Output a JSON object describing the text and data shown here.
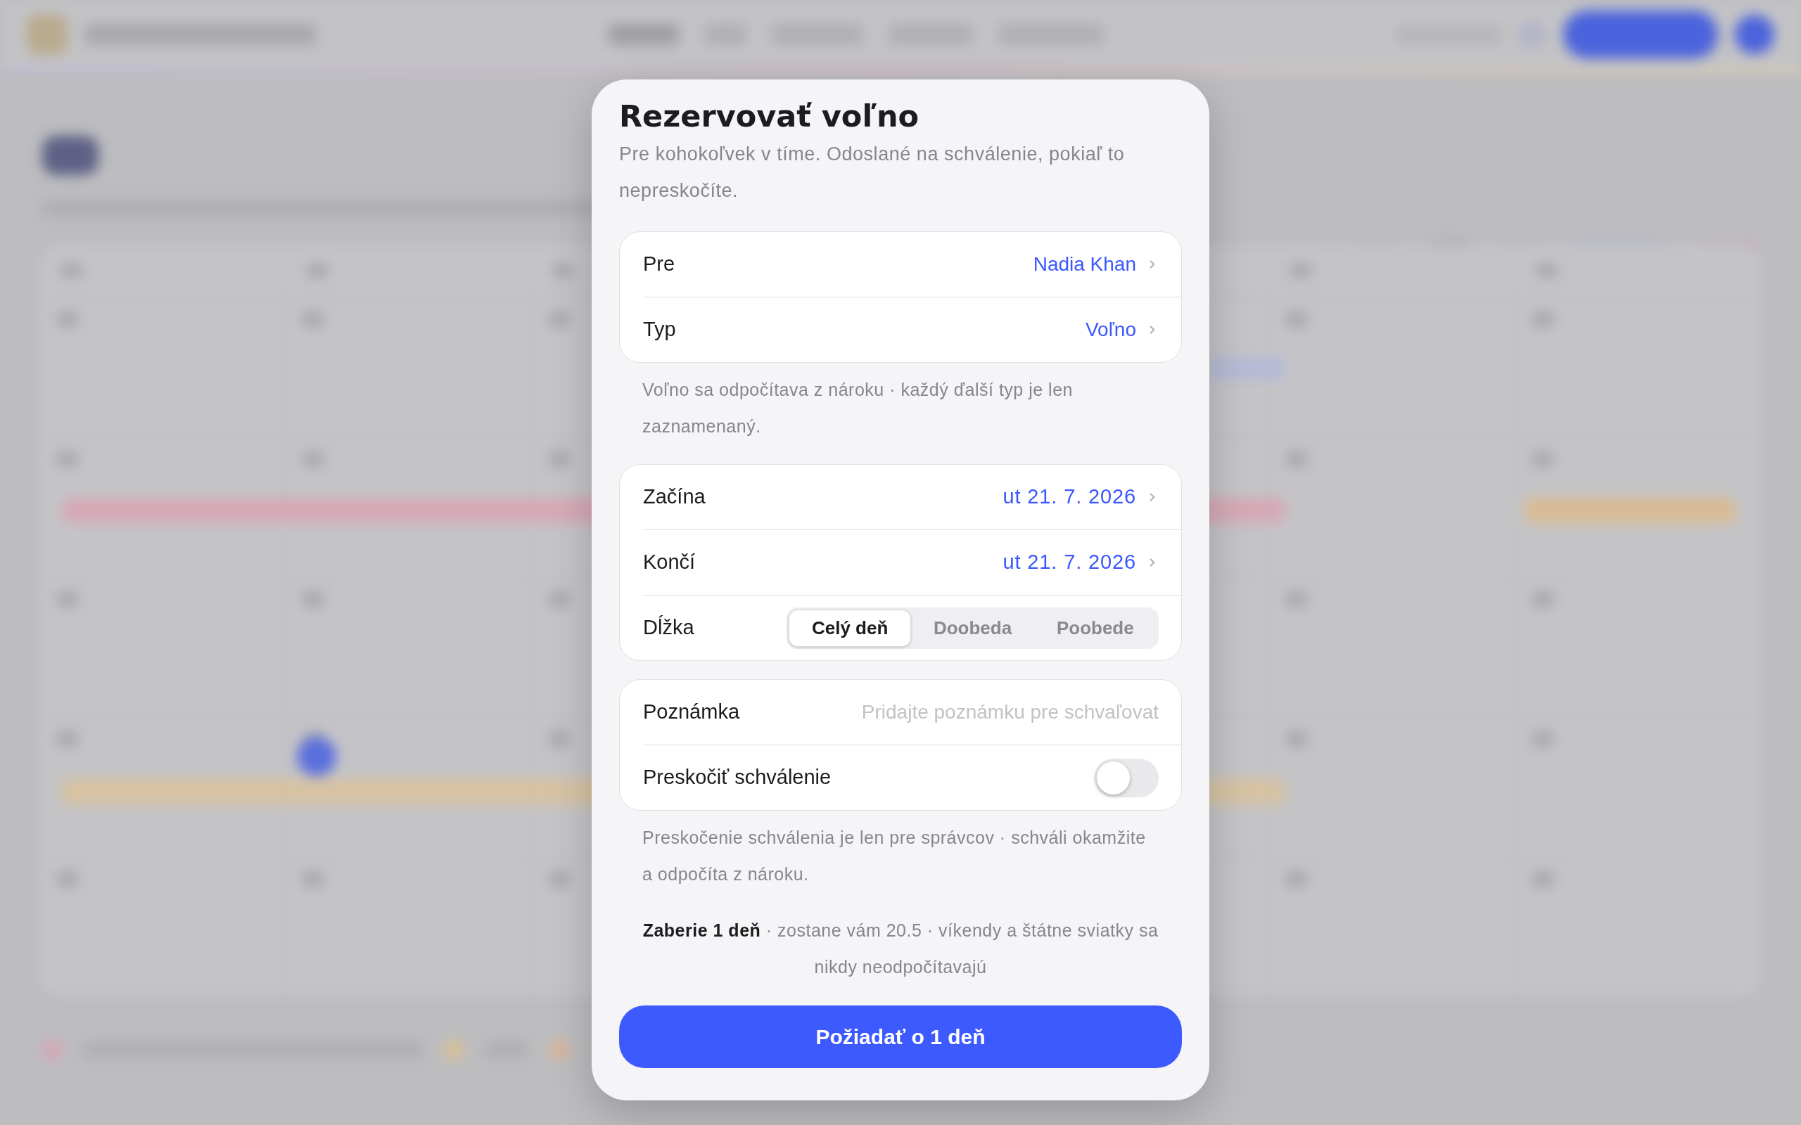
{
  "dialog": {
    "title": "Rezervovať voľno",
    "subtitle": "Pre kohokoľvek v tíme. Odoslané na schválenie, pokiaľ to nepreskočíte.",
    "groups": [
      {
        "rows": [
          {
            "kind": "picker",
            "label": "Pre",
            "value": "Nadia Khan"
          },
          {
            "kind": "picker",
            "label": "Typ",
            "value": "Voľno"
          }
        ],
        "note": "Voľno sa odpočítava z nároku · každý ďalší typ je len zaznamenaný."
      },
      {
        "rows": [
          {
            "kind": "date",
            "label": "Začína",
            "value": "ut 21. 7. 2026"
          },
          {
            "kind": "date",
            "label": "Končí",
            "value": "ut 21. 7. 2026"
          },
          {
            "kind": "segmented",
            "label": "Dĺžka",
            "options": [
              {
                "label": "Celý deň",
                "selected": true
              },
              {
                "label": "Doobeda",
                "selected": false
              },
              {
                "label": "Poobede",
                "selected": false
              }
            ]
          }
        ]
      },
      {
        "rows": [
          {
            "kind": "text_input",
            "label": "Poznámka",
            "placeholder": "Pridajte poznámku pre schvaľovat"
          },
          {
            "kind": "toggle",
            "label": "Preskočiť schválenie",
            "on": false
          }
        ],
        "note": "Preskočenie schválenia je len pre správcov · schváli okamžite a odpočíta z nároku."
      }
    ],
    "summary": "**Zaberie 1 deň** · zostane vám 20.5 · víkendy a štátne sviatky sa nikdy neodpočítavajú",
    "submit_button": "Požiadať o 1 deň"
  }
}
